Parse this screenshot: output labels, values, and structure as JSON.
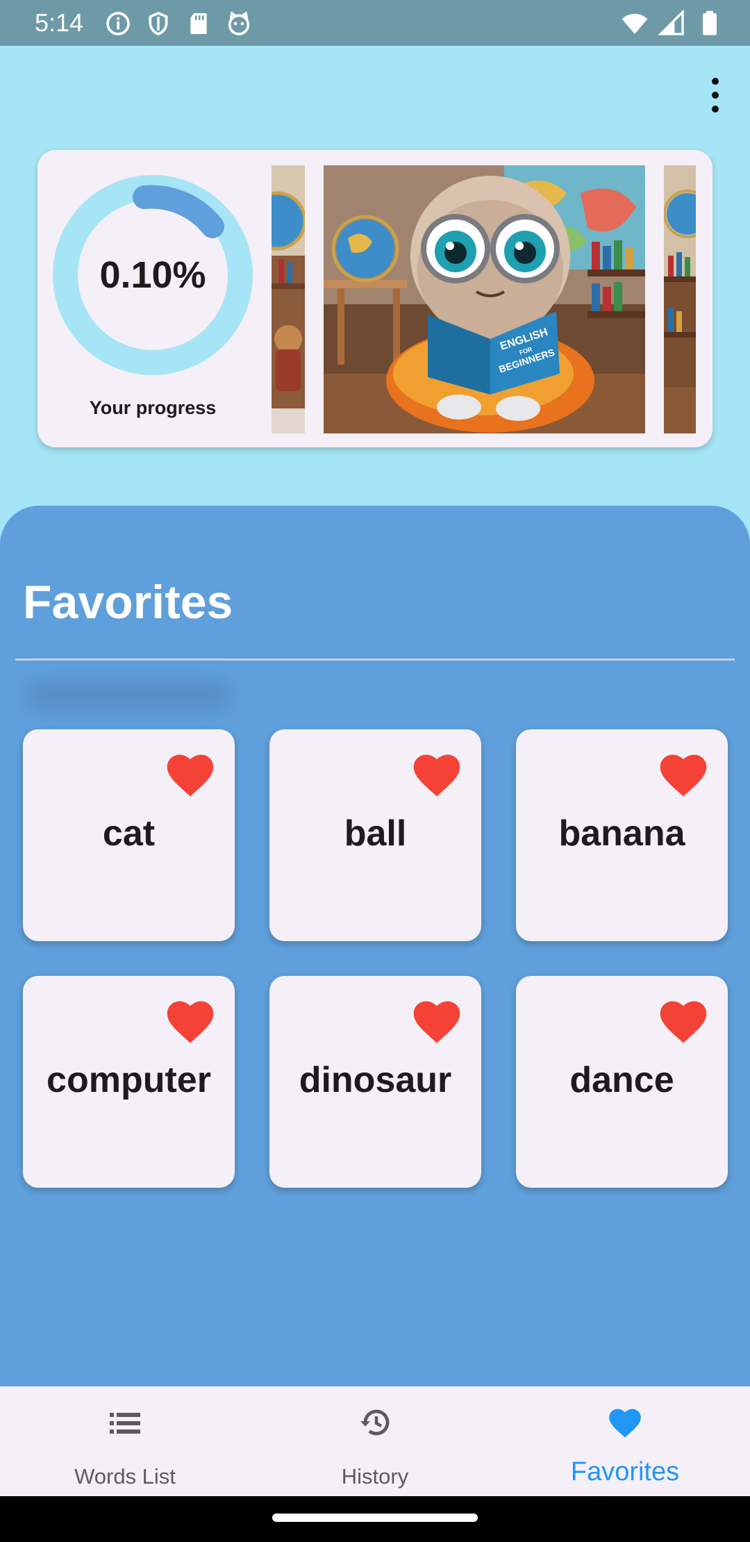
{
  "status_bar": {
    "time": "5:14",
    "icons_left": [
      "info-icon",
      "shield-icon",
      "sd-card-icon",
      "cat-face-icon"
    ],
    "icons_right": [
      "wifi-icon",
      "signal-icon",
      "battery-icon"
    ]
  },
  "top_bar": {
    "menu_icon": "more-vert-icon"
  },
  "progress": {
    "value_text": "0.10%",
    "label": "Your progress",
    "ring_colors": {
      "track": "#a6e5f5",
      "fill": "#5fa0dc"
    }
  },
  "carousel": {
    "image": "cartoon-character-reading-english-book",
    "book_text": [
      "ENGLISH",
      "FOR",
      "BEGINNERS"
    ]
  },
  "favorites": {
    "title": "Favorites",
    "words": [
      {
        "word": "cat",
        "favorited": true
      },
      {
        "word": "ball",
        "favorited": true
      },
      {
        "word": "banana",
        "favorited": true
      },
      {
        "word": "computer",
        "favorited": true
      },
      {
        "word": "dinosaur",
        "favorited": true
      },
      {
        "word": "dance",
        "favorited": true
      }
    ]
  },
  "bottom_nav": {
    "items": [
      {
        "label": "Words List",
        "icon": "list-icon",
        "active": false
      },
      {
        "label": "History",
        "icon": "history-icon",
        "active": false
      },
      {
        "label": "Favorites",
        "icon": "heart-icon",
        "active": true
      }
    ]
  },
  "colors": {
    "background": "#a6e5f5",
    "panel": "#5f9fdb",
    "card": "#f5f0f7",
    "heart": "#f44336",
    "active_nav": "#2196f3"
  }
}
